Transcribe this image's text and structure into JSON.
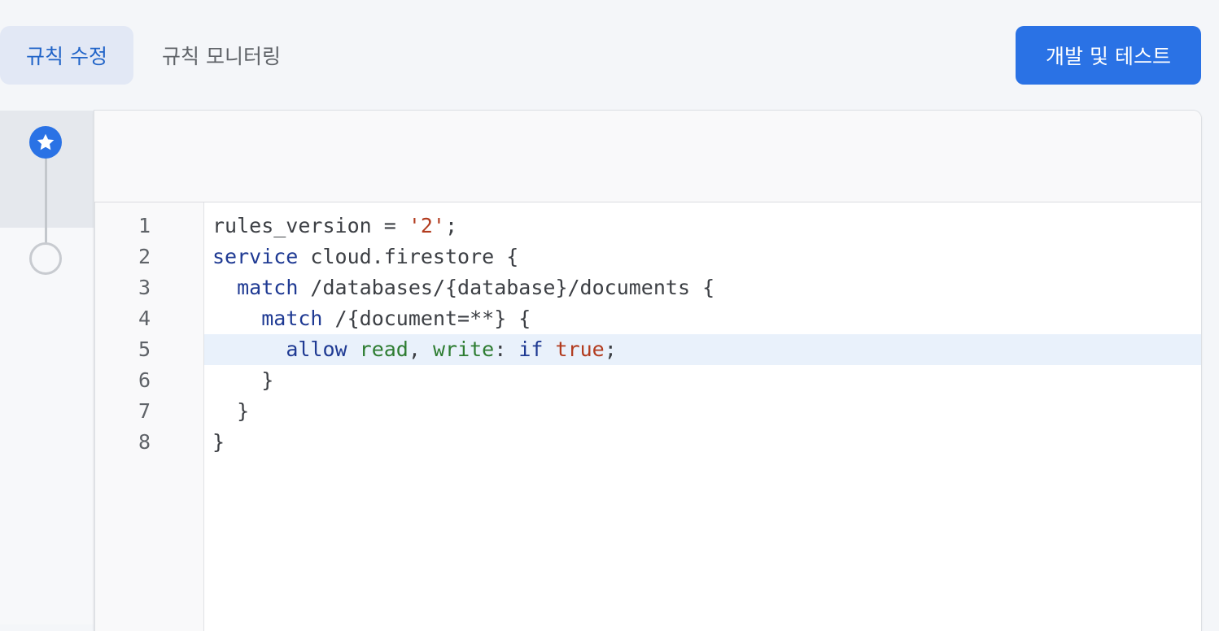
{
  "tabs": {
    "edit_rules": "규칙 수정",
    "monitor_rules": "규칙 모니터링"
  },
  "actions": {
    "develop_test": "개발 및 테스트"
  },
  "timeline": {
    "current_icon": "star-icon",
    "previous_icon": "circle-outline-icon"
  },
  "editor": {
    "active_line": 5,
    "line_numbers": [
      "1",
      "2",
      "3",
      "4",
      "5",
      "6",
      "7",
      "8"
    ],
    "lines": [
      [
        {
          "t": "rules_version = ",
          "c": ""
        },
        {
          "t": "'2'",
          "c": "str"
        },
        {
          "t": ";",
          "c": ""
        }
      ],
      [
        {
          "t": "service",
          "c": "kw"
        },
        {
          "t": " cloud.firestore {",
          "c": ""
        }
      ],
      [
        {
          "t": "  ",
          "c": ""
        },
        {
          "t": "match",
          "c": "kw"
        },
        {
          "t": " /databases/{database}/documents {",
          "c": ""
        }
      ],
      [
        {
          "t": "    ",
          "c": ""
        },
        {
          "t": "match",
          "c": "kw"
        },
        {
          "t": " /{document=**} {",
          "c": ""
        }
      ],
      [
        {
          "t": "      ",
          "c": ""
        },
        {
          "t": "allow",
          "c": "kw"
        },
        {
          "t": " ",
          "c": ""
        },
        {
          "t": "read",
          "c": "ident"
        },
        {
          "t": ", ",
          "c": ""
        },
        {
          "t": "write",
          "c": "ident"
        },
        {
          "t": ": ",
          "c": ""
        },
        {
          "t": "if",
          "c": "kw"
        },
        {
          "t": " ",
          "c": ""
        },
        {
          "t": "true",
          "c": "lit"
        },
        {
          "t": ";",
          "c": ""
        }
      ],
      [
        {
          "t": "    }",
          "c": ""
        }
      ],
      [
        {
          "t": "  }",
          "c": ""
        }
      ],
      [
        {
          "t": "}",
          "c": ""
        }
      ]
    ]
  },
  "colors": {
    "accent": "#2a72e5",
    "tab_active_bg": "#e2e8f5",
    "tab_active_text": "#2164c8",
    "keyword": "#1f3a93",
    "identifier": "#2e7d32",
    "string_literal": "#b23b1e",
    "active_line_bg": "#e9f1fb"
  }
}
